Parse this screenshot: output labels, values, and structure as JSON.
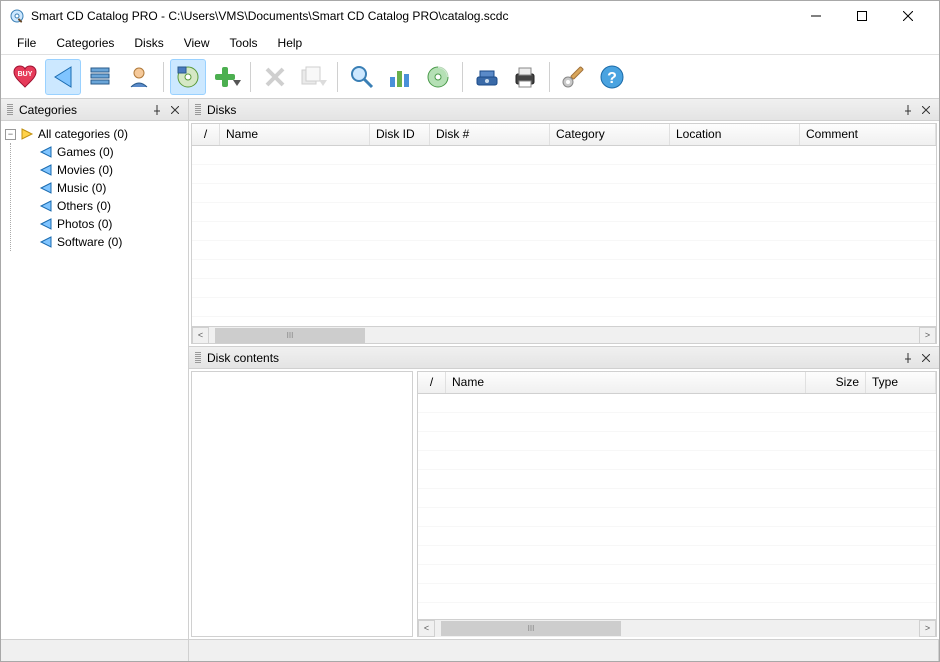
{
  "window": {
    "title": "Smart CD Catalog PRO - C:\\Users\\VMS\\Documents\\Smart CD Catalog PRO\\catalog.scdc"
  },
  "menu": {
    "file": "File",
    "categories": "Categories",
    "disks": "Disks",
    "view": "View",
    "tools": "Tools",
    "help": "Help"
  },
  "panels": {
    "categories": "Categories",
    "disks": "Disks",
    "contents": "Disk contents"
  },
  "tree": {
    "root": "All categories (0)",
    "items": [
      "Games (0)",
      "Movies (0)",
      "Music (0)",
      "Others (0)",
      "Photos (0)",
      "Software (0)"
    ]
  },
  "disks_columns": {
    "marker": "/",
    "name": "Name",
    "disk_id": "Disk ID",
    "disk_num": "Disk #",
    "category": "Category",
    "location": "Location",
    "comment": "Comment"
  },
  "contents_columns": {
    "marker": "/",
    "name": "Name",
    "size": "Size",
    "type": "Type"
  },
  "scroll_thumb_marker": "III"
}
